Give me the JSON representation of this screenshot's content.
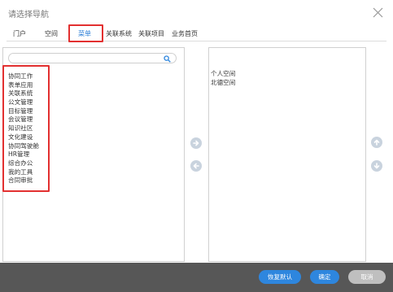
{
  "dialog": {
    "title": "请选择导航"
  },
  "tabs": [
    {
      "label": "门户"
    },
    {
      "label": "空间"
    },
    {
      "label": "菜单"
    },
    {
      "label": "关联系统"
    },
    {
      "label": "关联项目"
    },
    {
      "label": "业务首页"
    }
  ],
  "active_tab": "菜单",
  "search": {
    "value": "",
    "placeholder": ""
  },
  "left_list": [
    {
      "label": "协同工作"
    },
    {
      "label": "表单应用"
    },
    {
      "label": "关联系统"
    },
    {
      "label": "公文管理"
    },
    {
      "label": "目标管理"
    },
    {
      "label": "会议管理"
    },
    {
      "label": "知识社区"
    },
    {
      "label": "文化建设"
    },
    {
      "label": "协同驾驶舱"
    },
    {
      "label": "HR管理"
    },
    {
      "label": "综合办公"
    },
    {
      "label": "我的工具"
    },
    {
      "label": "合同审批"
    }
  ],
  "right_list": [
    {
      "label": "个人空间"
    },
    {
      "label": "北德空间"
    }
  ],
  "footer": {
    "restore_label": "恢复默认",
    "ok_label": "确定",
    "cancel_label": "取消"
  },
  "colors": {
    "accent": "#2e86de",
    "highlight_box": "#e23030",
    "footer_bg": "#575757",
    "arrow_button": "#c9d3de"
  }
}
